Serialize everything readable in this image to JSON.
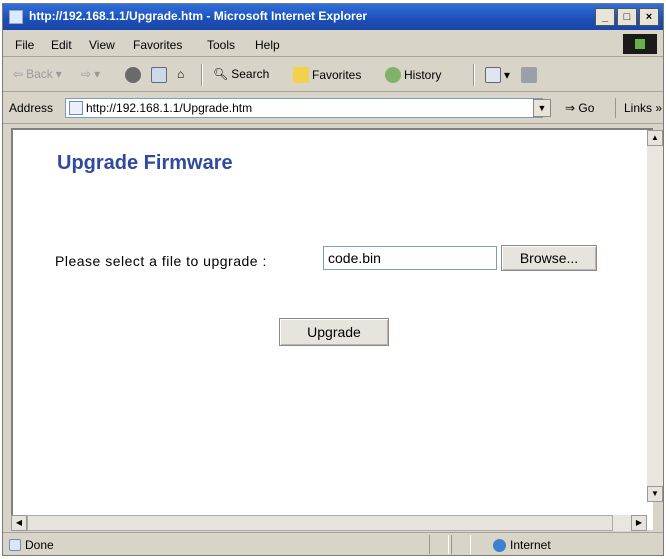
{
  "window": {
    "title": "http://192.168.1.1/Upgrade.htm - Microsoft Internet Explorer",
    "controls": [
      "_",
      "□",
      "×"
    ]
  },
  "menu": {
    "items": [
      "File",
      "Edit",
      "View",
      "Favorites",
      "Tools",
      "Help"
    ]
  },
  "toolbar": {
    "back": "Back",
    "search": "Search",
    "favorites": "Favorites",
    "history": "History"
  },
  "address": {
    "label": "Address",
    "url": "http://192.168.1.1/Upgrade.htm",
    "go": "Go",
    "links": "Links »"
  },
  "page": {
    "title": "Upgrade Firmware",
    "file_label": "Please select a file to upgrade :",
    "file_value": "code.bin",
    "browse_label": "Browse...",
    "upgrade_label": "Upgrade"
  },
  "status": {
    "text": "Done",
    "zone": "Internet"
  },
  "colors": {
    "title_bar": "#1c4fb8",
    "page_title": "#2f4a9f",
    "chrome": "#d8d4c8"
  }
}
